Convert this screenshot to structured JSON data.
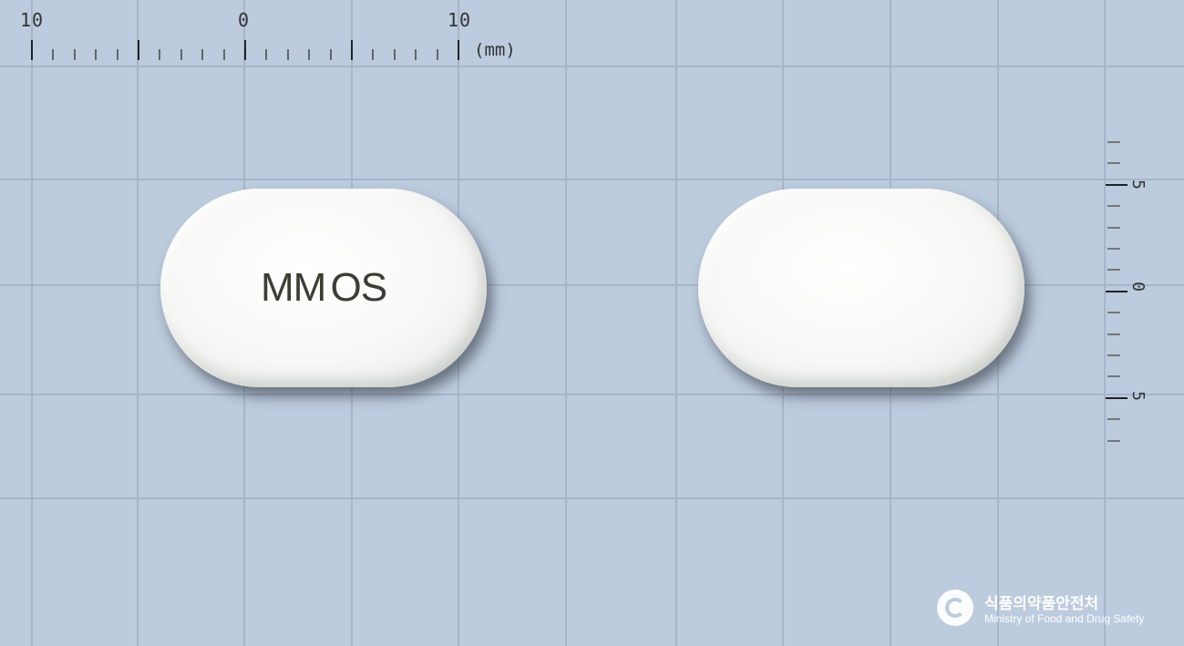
{
  "ruler_top": {
    "labels": [
      "10",
      "0",
      "10"
    ],
    "unit": "(mm)"
  },
  "ruler_right": {
    "labels": [
      "5",
      "0",
      "5"
    ]
  },
  "pills": [
    {
      "imprint": "MM OS"
    },
    {
      "imprint": ""
    }
  ],
  "logo": {
    "korean": "식품의약품안전처",
    "english": "Ministry of Food and Drug Safety"
  },
  "colors": {
    "background": "#bccbde",
    "grid": "#a7b5c8",
    "pill": "#f8f8f6",
    "imprint": "#3c3e33"
  }
}
